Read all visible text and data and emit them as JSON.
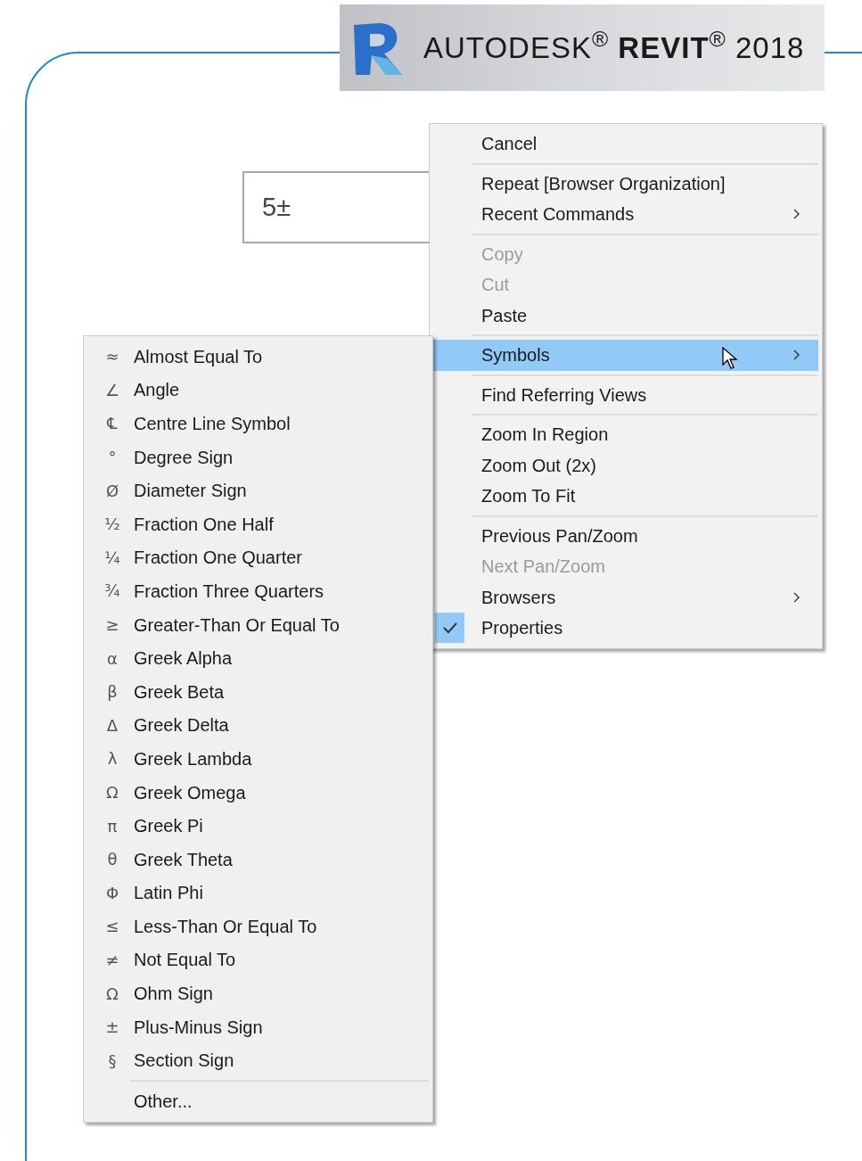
{
  "banner": {
    "text": "AUTODESK$^{®}$ **REVIT**$^{®}$ 2018"
  },
  "field": {
    "value": "5±"
  },
  "context_menu": {
    "items": [
      {
        "kind": "item",
        "label": "Cancel",
        "disabled": false,
        "selected": false,
        "checked": false,
        "submenu": false
      },
      {
        "kind": "separator"
      },
      {
        "kind": "item",
        "label": "Repeat [Browser Organization]",
        "disabled": false,
        "selected": false,
        "checked": false,
        "submenu": false
      },
      {
        "kind": "item",
        "label": "Recent Commands",
        "disabled": false,
        "selected": false,
        "checked": false,
        "submenu": true
      },
      {
        "kind": "separator"
      },
      {
        "kind": "item",
        "label": "Copy",
        "disabled": true,
        "selected": false,
        "checked": false,
        "submenu": false
      },
      {
        "kind": "item",
        "label": "Cut",
        "disabled": true,
        "selected": false,
        "checked": false,
        "submenu": false
      },
      {
        "kind": "item",
        "label": "Paste",
        "disabled": false,
        "selected": false,
        "checked": false,
        "submenu": false
      },
      {
        "kind": "separator"
      },
      {
        "kind": "item",
        "label": "Symbols",
        "disabled": false,
        "selected": true,
        "checked": false,
        "submenu": true
      },
      {
        "kind": "separator"
      },
      {
        "kind": "item",
        "label": "Find Referring Views",
        "disabled": false,
        "selected": false,
        "checked": false,
        "submenu": false
      },
      {
        "kind": "separator"
      },
      {
        "kind": "item",
        "label": "Zoom In Region",
        "disabled": false,
        "selected": false,
        "checked": false,
        "submenu": false
      },
      {
        "kind": "item",
        "label": "Zoom Out (2x)",
        "disabled": false,
        "selected": false,
        "checked": false,
        "submenu": false
      },
      {
        "kind": "item",
        "label": "Zoom To Fit",
        "disabled": false,
        "selected": false,
        "checked": false,
        "submenu": false
      },
      {
        "kind": "separator"
      },
      {
        "kind": "item",
        "label": "Previous Pan/Zoom",
        "disabled": false,
        "selected": false,
        "checked": false,
        "submenu": false
      },
      {
        "kind": "item",
        "label": "Next Pan/Zoom",
        "disabled": true,
        "selected": false,
        "checked": false,
        "submenu": false
      },
      {
        "kind": "item",
        "label": "Browsers",
        "disabled": false,
        "selected": false,
        "checked": false,
        "submenu": true
      },
      {
        "kind": "item",
        "label": "Properties",
        "disabled": false,
        "selected": false,
        "checked": true,
        "submenu": false
      }
    ]
  },
  "symbols_menu": {
    "items": [
      {
        "kind": "item",
        "symbol": "≈",
        "label": "Almost Equal To"
      },
      {
        "kind": "item",
        "symbol": "∠",
        "label": "Angle"
      },
      {
        "kind": "item",
        "symbol": "℄",
        "label": "Centre Line Symbol"
      },
      {
        "kind": "item",
        "symbol": "°",
        "label": "Degree Sign"
      },
      {
        "kind": "item",
        "symbol": "Ø",
        "label": "Diameter Sign"
      },
      {
        "kind": "item",
        "symbol": "½",
        "label": "Fraction One Half"
      },
      {
        "kind": "item",
        "symbol": "¼",
        "label": "Fraction One Quarter"
      },
      {
        "kind": "item",
        "symbol": "¾",
        "label": "Fraction Three Quarters"
      },
      {
        "kind": "item",
        "symbol": "≥",
        "label": "Greater-Than Or Equal To"
      },
      {
        "kind": "item",
        "symbol": "α",
        "label": "Greek Alpha"
      },
      {
        "kind": "item",
        "symbol": "β",
        "label": "Greek Beta"
      },
      {
        "kind": "item",
        "symbol": "Δ",
        "label": "Greek Delta"
      },
      {
        "kind": "item",
        "symbol": "λ",
        "label": "Greek Lambda"
      },
      {
        "kind": "item",
        "symbol": "Ω",
        "label": "Greek Omega"
      },
      {
        "kind": "item",
        "symbol": "π",
        "label": "Greek Pi"
      },
      {
        "kind": "item",
        "symbol": "θ",
        "label": "Greek Theta"
      },
      {
        "kind": "item",
        "symbol": "Φ",
        "label": "Latin Phi"
      },
      {
        "kind": "item",
        "symbol": "≤",
        "label": "Less-Than Or Equal To"
      },
      {
        "kind": "item",
        "symbol": "≠",
        "label": "Not Equal To"
      },
      {
        "kind": "item",
        "symbol": "Ω",
        "label": "Ohm Sign"
      },
      {
        "kind": "item",
        "symbol": "±",
        "label": "Plus-Minus Sign"
      },
      {
        "kind": "item",
        "symbol": "§",
        "label": "Section Sign"
      },
      {
        "kind": "separator"
      },
      {
        "kind": "item",
        "label": "Other..."
      }
    ]
  }
}
